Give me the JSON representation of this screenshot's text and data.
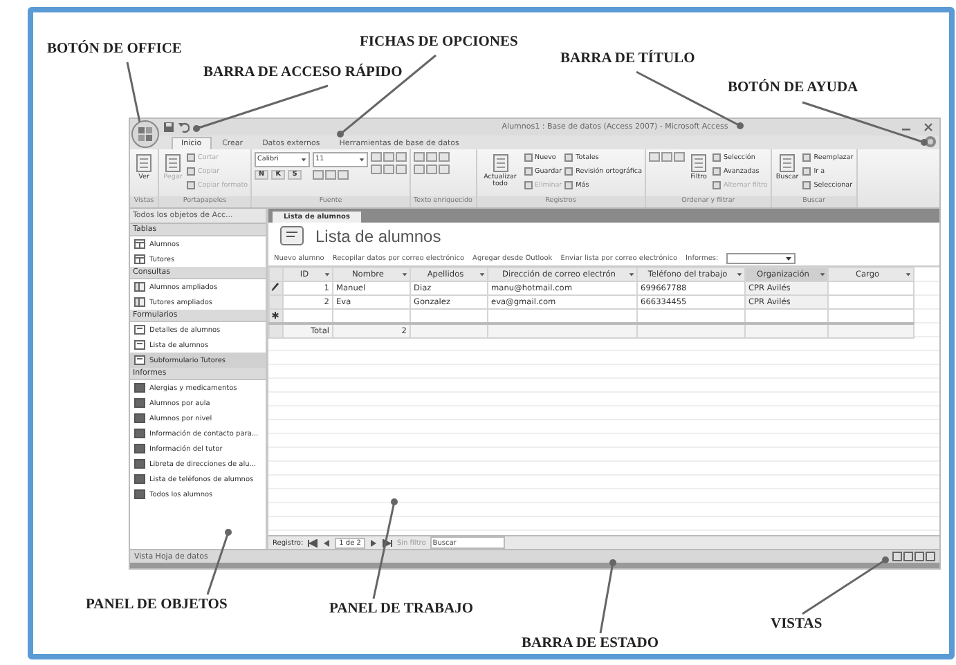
{
  "annotations": [
    {
      "text": "BOTÓN DE OFFICE"
    },
    {
      "text": "BARRA DE ACCESO RÁPIDO"
    },
    {
      "text": "FICHAS DE OPCIONES"
    },
    {
      "text": "BARRA DE TÍTULO"
    },
    {
      "text": "BOTÓN DE AYUDA"
    },
    {
      "text": "PANEL DE OBJETOS"
    },
    {
      "text": "PANEL DE TRABAJO"
    },
    {
      "text": "BARRA DE ESTADO"
    },
    {
      "text": "VISTAS"
    }
  ],
  "window": {
    "title": "Alumnos1 : Base de datos (Access 2007) - Microsoft Access",
    "tabs": [
      {
        "label": "Inicio",
        "selected": true
      },
      {
        "label": "Crear",
        "selected": false
      },
      {
        "label": "Datos externos",
        "selected": false
      },
      {
        "label": "Herramientas de base de datos",
        "selected": false
      }
    ]
  },
  "ribbon": {
    "groups": [
      {
        "label": "Vistas",
        "columns": [
          [
            {
              "kind": "large",
              "label": "Ver",
              "disabled": false
            }
          ]
        ]
      },
      {
        "label": "Portapapeles",
        "columns": [
          [
            {
              "kind": "large",
              "label": "Pegar",
              "disabled": true
            }
          ],
          [
            {
              "kind": "small",
              "label": "Cortar",
              "disabled": true
            },
            {
              "kind": "small",
              "label": "Copiar",
              "disabled": true
            },
            {
              "kind": "small",
              "label": "Copiar formato",
              "disabled": true
            }
          ]
        ]
      },
      {
        "label": "Fuente",
        "columns": [
          [
            {
              "kind": "combo",
              "label": "Calibri"
            },
            {
              "kind": "glyphs",
              "labels": [
                "N",
                "K",
                "S"
              ]
            }
          ],
          [
            {
              "kind": "combo",
              "label": "11"
            },
            {
              "kind": "icons"
            }
          ],
          [
            {
              "kind": "icons"
            },
            {
              "kind": "icons"
            }
          ]
        ]
      },
      {
        "label": "Texto enriquecido",
        "columns": [
          [
            {
              "kind": "icons"
            },
            {
              "kind": "icons"
            }
          ]
        ]
      },
      {
        "label": "Registros",
        "columns": [
          [
            {
              "kind": "large",
              "label": "Actualizar todo",
              "disabled": false
            }
          ],
          [
            {
              "kind": "small",
              "label": "Nuevo",
              "disabled": false
            },
            {
              "kind": "small",
              "label": "Guardar",
              "disabled": false
            },
            {
              "kind": "small",
              "label": "Eliminar",
              "disabled": true
            }
          ],
          [
            {
              "kind": "small",
              "label": "Totales",
              "disabled": false
            },
            {
              "kind": "small",
              "label": "Revisión ortográfica",
              "disabled": false
            },
            {
              "kind": "small",
              "label": "Más",
              "disabled": false
            }
          ]
        ]
      },
      {
        "label": "Ordenar y filtrar",
        "columns": [
          [
            {
              "kind": "icons"
            }
          ],
          [
            {
              "kind": "large",
              "label": "Filtro",
              "disabled": false
            }
          ],
          [
            {
              "kind": "small",
              "label": "Selección",
              "disabled": false
            },
            {
              "kind": "small",
              "label": "Avanzadas",
              "disabled": false
            },
            {
              "kind": "small",
              "label": "Alternar filtro",
              "disabled": true
            }
          ]
        ]
      },
      {
        "label": "Buscar",
        "columns": [
          [
            {
              "kind": "large",
              "label": "Buscar",
              "disabled": false
            }
          ],
          [
            {
              "kind": "small",
              "label": "Reemplazar",
              "disabled": false
            },
            {
              "kind": "small",
              "label": "Ir a",
              "disabled": false
            },
            {
              "kind": "small",
              "label": "Seleccionar",
              "disabled": false
            }
          ]
        ]
      }
    ]
  },
  "nav": {
    "header": "Todos los objetos de Acc...",
    "groups": [
      {
        "label": "Tablas",
        "kind": "table",
        "items": [
          {
            "label": "Alumnos",
            "selected": false
          },
          {
            "label": "Tutores",
            "selected": false
          }
        ]
      },
      {
        "label": "Consultas",
        "kind": "query",
        "items": [
          {
            "label": "Alumnos ampliados",
            "selected": false
          },
          {
            "label": "Tutores ampliados",
            "selected": false
          }
        ]
      },
      {
        "label": "Formularios",
        "kind": "form",
        "items": [
          {
            "label": "Detalles de alumnos",
            "selected": false
          },
          {
            "label": "Lista de alumnos",
            "selected": false
          },
          {
            "label": "Subformulario Tutores",
            "selected": true
          }
        ]
      },
      {
        "label": "Informes",
        "kind": "report",
        "items": [
          {
            "label": "Alergias y medicamentos",
            "selected": false
          },
          {
            "label": "Alumnos por aula",
            "selected": false
          },
          {
            "label": "Alumnos por nivel",
            "selected": false
          },
          {
            "label": "Información de contacto para...",
            "selected": false
          },
          {
            "label": "Información del tutor",
            "selected": false
          },
          {
            "label": "Libreta de direcciones de alu...",
            "selected": false
          },
          {
            "label": "Lista de teléfonos de alumnos",
            "selected": false
          },
          {
            "label": "Todos los alumnos",
            "selected": false
          }
        ]
      }
    ]
  },
  "document": {
    "tab": "Lista de alumnos",
    "heading": "Lista de alumnos",
    "actions": [
      "Nuevo alumno",
      "Recopilar datos por correo electrónico",
      "Agregar desde Outlook",
      "Enviar lista por correo electrónico"
    ],
    "report_label": "Informes:",
    "table": {
      "columns": [
        {
          "label": "ID",
          "selected": false
        },
        {
          "label": "Nombre",
          "selected": false
        },
        {
          "label": "Apellidos",
          "selected": false
        },
        {
          "label": "Dirección de correo electrón",
          "selected": false
        },
        {
          "label": "Teléfono del trabajo",
          "selected": false
        },
        {
          "label": "Organización",
          "selected": true
        },
        {
          "label": "Cargo",
          "selected": false
        }
      ],
      "rows": [
        {
          "editing": true,
          "cells": [
            "1",
            "Manuel",
            "Diaz",
            "manu@hotmail.com",
            "699667788",
            "CPR Avilés"
          ]
        },
        {
          "editing": false,
          "cells": [
            "2",
            "Eva",
            "Gonzalez",
            "eva@gmail.com",
            "666334455",
            "CPR Avilés"
          ]
        }
      ],
      "totals": {
        "label": "Total",
        "count": "2"
      }
    },
    "record_nav": {
      "label": "Registro:",
      "position": "1 de 2",
      "filter": "Sin filtro",
      "search_placeholder": "Buscar"
    }
  },
  "status_bar": {
    "text": "Vista Hoja de datos"
  }
}
